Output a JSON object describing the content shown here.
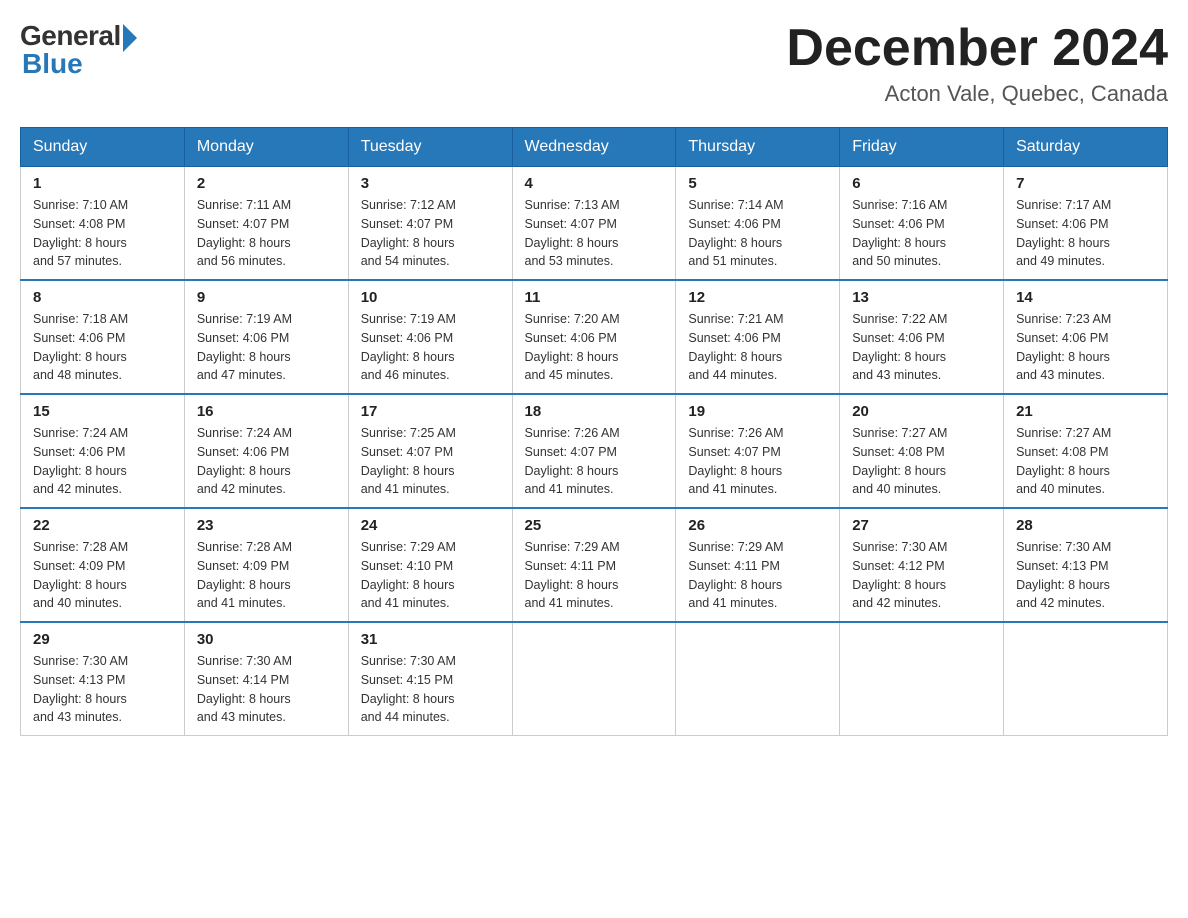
{
  "header": {
    "logo_general": "General",
    "logo_blue": "Blue",
    "month_title": "December 2024",
    "location": "Acton Vale, Quebec, Canada"
  },
  "days_of_week": [
    "Sunday",
    "Monday",
    "Tuesday",
    "Wednesday",
    "Thursday",
    "Friday",
    "Saturday"
  ],
  "weeks": [
    [
      {
        "day": "1",
        "sunrise": "7:10 AM",
        "sunset": "4:08 PM",
        "daylight": "8 hours and 57 minutes."
      },
      {
        "day": "2",
        "sunrise": "7:11 AM",
        "sunset": "4:07 PM",
        "daylight": "8 hours and 56 minutes."
      },
      {
        "day": "3",
        "sunrise": "7:12 AM",
        "sunset": "4:07 PM",
        "daylight": "8 hours and 54 minutes."
      },
      {
        "day": "4",
        "sunrise": "7:13 AM",
        "sunset": "4:07 PM",
        "daylight": "8 hours and 53 minutes."
      },
      {
        "day": "5",
        "sunrise": "7:14 AM",
        "sunset": "4:06 PM",
        "daylight": "8 hours and 51 minutes."
      },
      {
        "day": "6",
        "sunrise": "7:16 AM",
        "sunset": "4:06 PM",
        "daylight": "8 hours and 50 minutes."
      },
      {
        "day": "7",
        "sunrise": "7:17 AM",
        "sunset": "4:06 PM",
        "daylight": "8 hours and 49 minutes."
      }
    ],
    [
      {
        "day": "8",
        "sunrise": "7:18 AM",
        "sunset": "4:06 PM",
        "daylight": "8 hours and 48 minutes."
      },
      {
        "day": "9",
        "sunrise": "7:19 AM",
        "sunset": "4:06 PM",
        "daylight": "8 hours and 47 minutes."
      },
      {
        "day": "10",
        "sunrise": "7:19 AM",
        "sunset": "4:06 PM",
        "daylight": "8 hours and 46 minutes."
      },
      {
        "day": "11",
        "sunrise": "7:20 AM",
        "sunset": "4:06 PM",
        "daylight": "8 hours and 45 minutes."
      },
      {
        "day": "12",
        "sunrise": "7:21 AM",
        "sunset": "4:06 PM",
        "daylight": "8 hours and 44 minutes."
      },
      {
        "day": "13",
        "sunrise": "7:22 AM",
        "sunset": "4:06 PM",
        "daylight": "8 hours and 43 minutes."
      },
      {
        "day": "14",
        "sunrise": "7:23 AM",
        "sunset": "4:06 PM",
        "daylight": "8 hours and 43 minutes."
      }
    ],
    [
      {
        "day": "15",
        "sunrise": "7:24 AM",
        "sunset": "4:06 PM",
        "daylight": "8 hours and 42 minutes."
      },
      {
        "day": "16",
        "sunrise": "7:24 AM",
        "sunset": "4:06 PM",
        "daylight": "8 hours and 42 minutes."
      },
      {
        "day": "17",
        "sunrise": "7:25 AM",
        "sunset": "4:07 PM",
        "daylight": "8 hours and 41 minutes."
      },
      {
        "day": "18",
        "sunrise": "7:26 AM",
        "sunset": "4:07 PM",
        "daylight": "8 hours and 41 minutes."
      },
      {
        "day": "19",
        "sunrise": "7:26 AM",
        "sunset": "4:07 PM",
        "daylight": "8 hours and 41 minutes."
      },
      {
        "day": "20",
        "sunrise": "7:27 AM",
        "sunset": "4:08 PM",
        "daylight": "8 hours and 40 minutes."
      },
      {
        "day": "21",
        "sunrise": "7:27 AM",
        "sunset": "4:08 PM",
        "daylight": "8 hours and 40 minutes."
      }
    ],
    [
      {
        "day": "22",
        "sunrise": "7:28 AM",
        "sunset": "4:09 PM",
        "daylight": "8 hours and 40 minutes."
      },
      {
        "day": "23",
        "sunrise": "7:28 AM",
        "sunset": "4:09 PM",
        "daylight": "8 hours and 41 minutes."
      },
      {
        "day": "24",
        "sunrise": "7:29 AM",
        "sunset": "4:10 PM",
        "daylight": "8 hours and 41 minutes."
      },
      {
        "day": "25",
        "sunrise": "7:29 AM",
        "sunset": "4:11 PM",
        "daylight": "8 hours and 41 minutes."
      },
      {
        "day": "26",
        "sunrise": "7:29 AM",
        "sunset": "4:11 PM",
        "daylight": "8 hours and 41 minutes."
      },
      {
        "day": "27",
        "sunrise": "7:30 AM",
        "sunset": "4:12 PM",
        "daylight": "8 hours and 42 minutes."
      },
      {
        "day": "28",
        "sunrise": "7:30 AM",
        "sunset": "4:13 PM",
        "daylight": "8 hours and 42 minutes."
      }
    ],
    [
      {
        "day": "29",
        "sunrise": "7:30 AM",
        "sunset": "4:13 PM",
        "daylight": "8 hours and 43 minutes."
      },
      {
        "day": "30",
        "sunrise": "7:30 AM",
        "sunset": "4:14 PM",
        "daylight": "8 hours and 43 minutes."
      },
      {
        "day": "31",
        "sunrise": "7:30 AM",
        "sunset": "4:15 PM",
        "daylight": "8 hours and 44 minutes."
      },
      null,
      null,
      null,
      null
    ]
  ],
  "labels": {
    "sunrise": "Sunrise:",
    "sunset": "Sunset:",
    "daylight": "Daylight:"
  }
}
